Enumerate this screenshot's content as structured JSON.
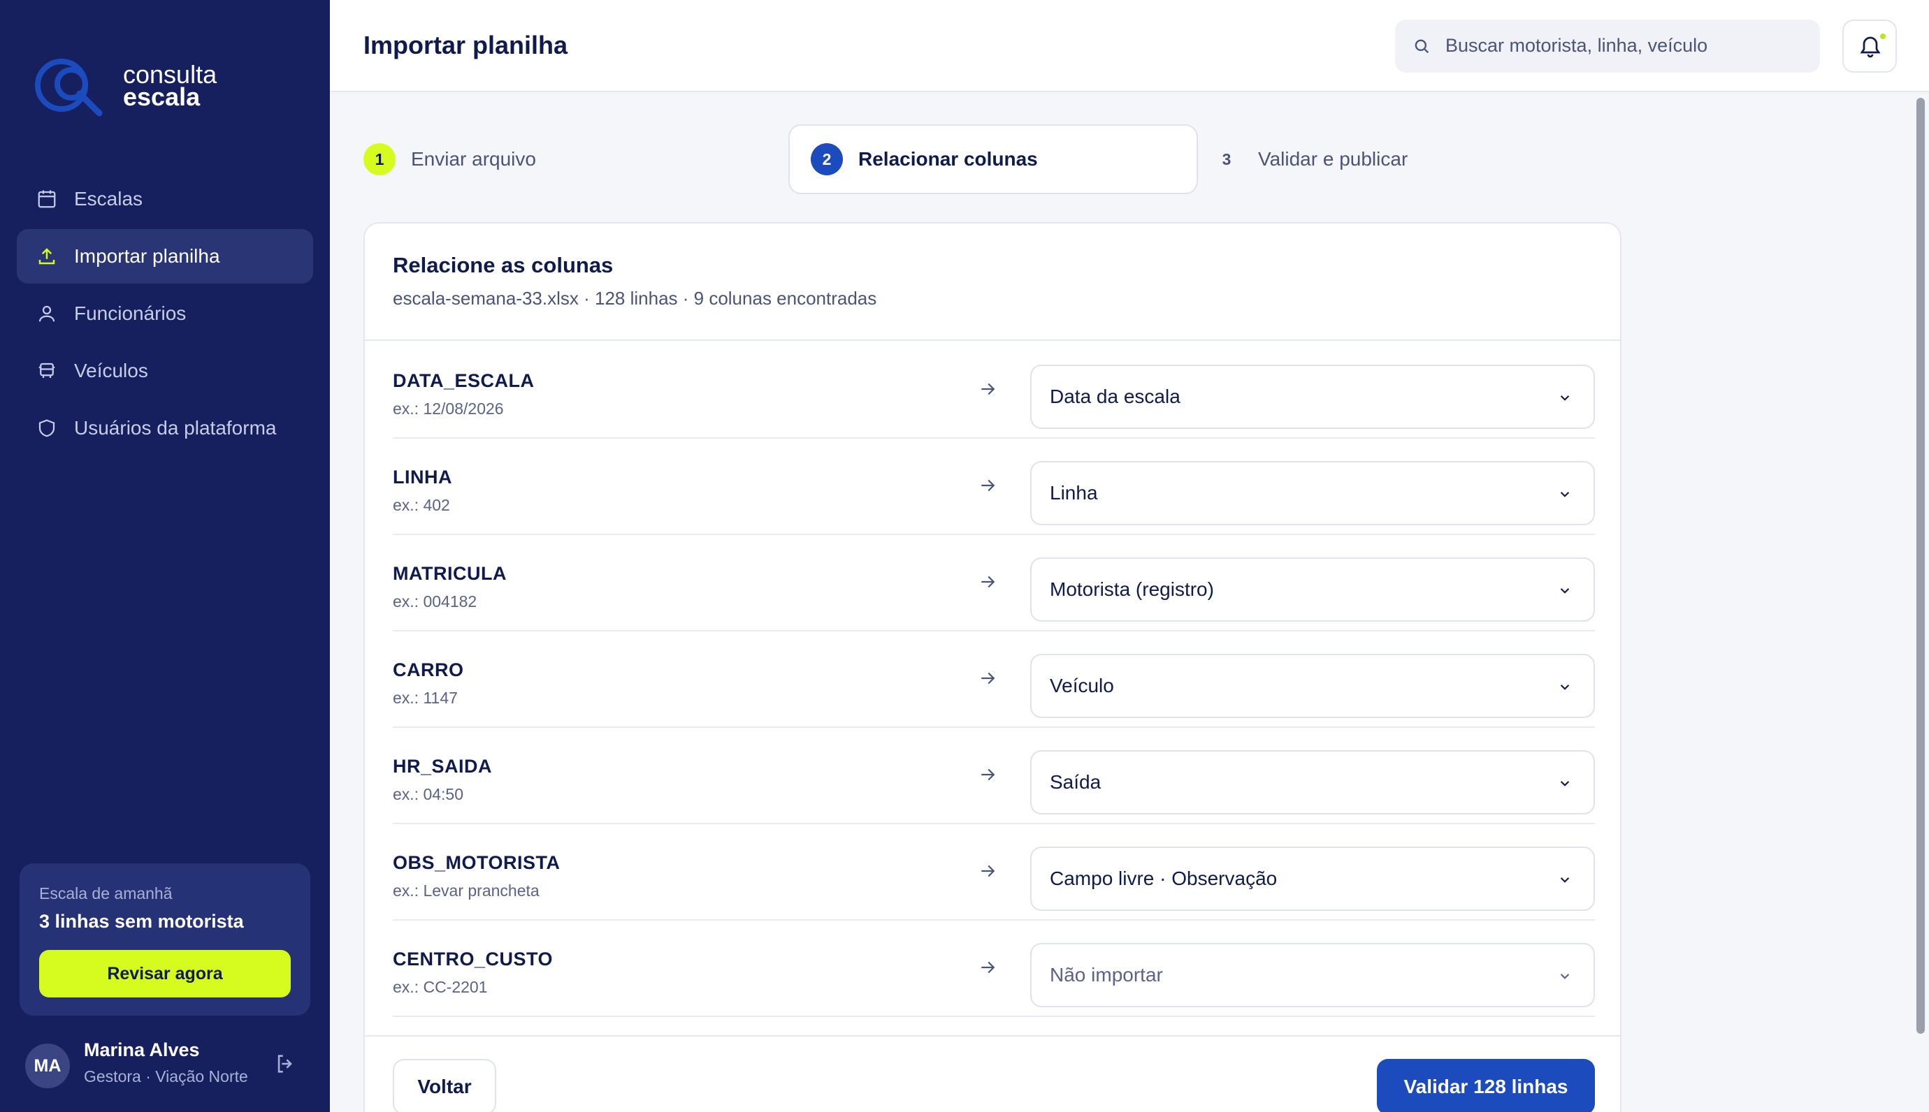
{
  "brand": {
    "line1": "consulta",
    "line2": "escala",
    "accent": "#1b4bbd"
  },
  "sidebar": {
    "items": [
      {
        "label": "Escalas",
        "icon": "calendar-icon",
        "active": false
      },
      {
        "label": "Importar planilha",
        "icon": "upload-icon",
        "active": true
      },
      {
        "label": "Funcionários",
        "icon": "user-icon",
        "active": false
      },
      {
        "label": "Veículos",
        "icon": "bus-icon",
        "active": false
      },
      {
        "label": "Usuários da plataforma",
        "icon": "shield-icon",
        "active": false
      }
    ],
    "promo": {
      "subtitle": "Escala de amanhã",
      "title": "3 linhas sem motorista",
      "button": "Revisar agora"
    },
    "user": {
      "initials": "MA",
      "name": "Marina Alves",
      "role": "Gestora · Viação Norte"
    }
  },
  "header": {
    "title": "Importar planilha",
    "search_placeholder": "Buscar motorista, linha, veículo"
  },
  "steps": [
    {
      "number": "1",
      "label": "Enviar arquivo",
      "state": "done"
    },
    {
      "number": "2",
      "label": "Relacionar colunas",
      "state": "current"
    },
    {
      "number": "3",
      "label": "Validar e publicar",
      "state": "upcoming"
    }
  ],
  "card": {
    "title": "Relacione as colunas",
    "subtitle": "escala-semana-33.xlsx · 128 linhas · 9 colunas encontradas",
    "rows": [
      {
        "column": "DATA_ESCALA",
        "example": "ex.: 12/08/2026",
        "mapping": "Data da escala"
      },
      {
        "column": "LINHA",
        "example": "ex.: 402",
        "mapping": "Linha"
      },
      {
        "column": "MATRICULA",
        "example": "ex.: 004182",
        "mapping": "Motorista (registro)"
      },
      {
        "column": "CARRO",
        "example": "ex.: 1147",
        "mapping": "Veículo"
      },
      {
        "column": "HR_SAIDA",
        "example": "ex.: 04:50",
        "mapping": "Saída"
      },
      {
        "column": "OBS_MOTORISTA",
        "example": "ex.: Levar prancheta",
        "mapping": "Campo livre · Observação"
      },
      {
        "column": "CENTRO_CUSTO",
        "example": "ex.: CC-2201",
        "mapping": "Não importar"
      }
    ],
    "back_button": "Voltar",
    "validate_button": "Validar 128 linhas"
  }
}
